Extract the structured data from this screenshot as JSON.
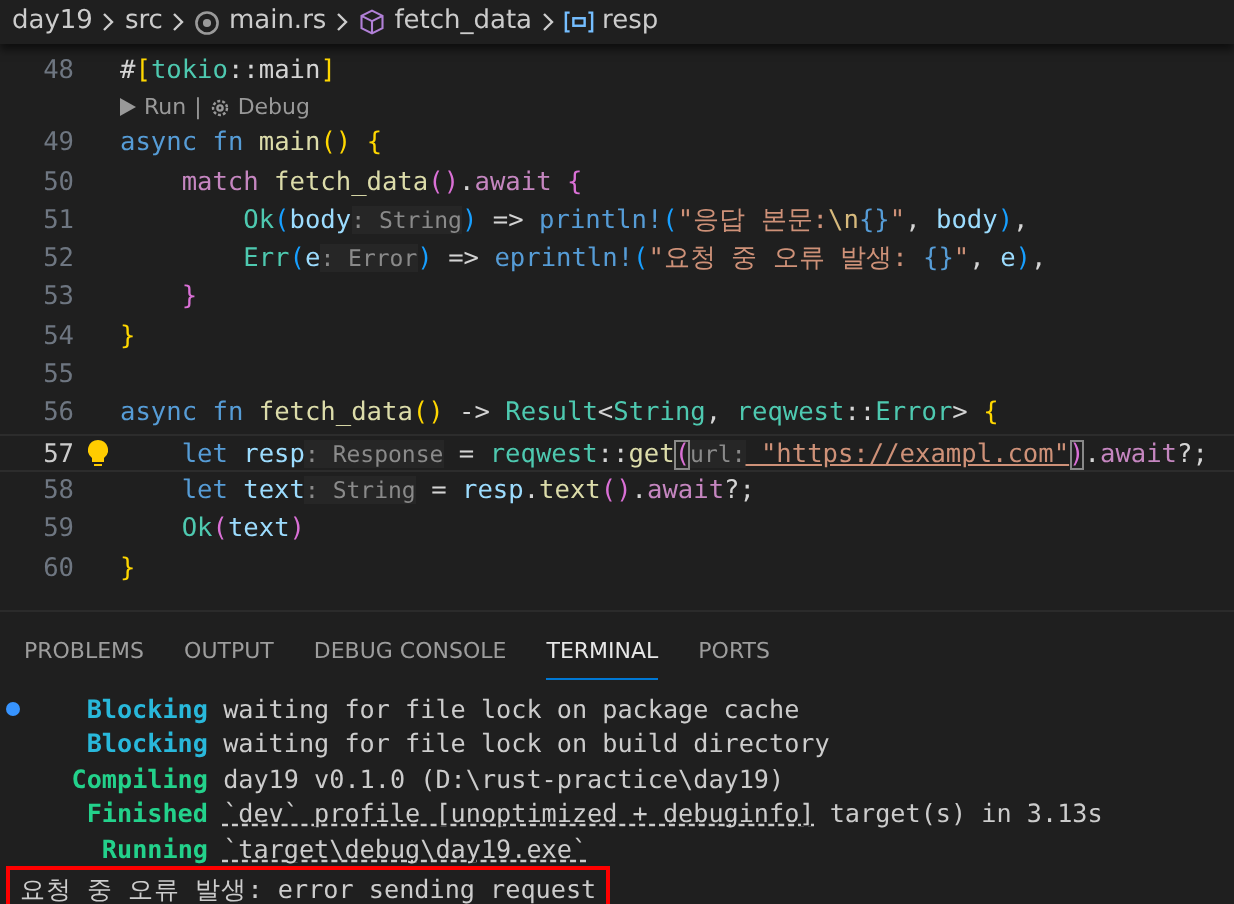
{
  "breadcrumb": [
    {
      "label": "day19",
      "kind": "folder"
    },
    {
      "label": "src",
      "kind": "folder"
    },
    {
      "label": "main.rs",
      "kind": "file"
    },
    {
      "label": "fetch_data",
      "kind": "function"
    },
    {
      "label": "resp",
      "kind": "variable"
    }
  ],
  "editor": {
    "lines": [
      {
        "number": "48",
        "current": false,
        "lightbulb": false,
        "tokens": [
          {
            "text": "#",
            "kind": "plain"
          },
          {
            "text": "[",
            "kind": "b1"
          },
          {
            "text": "tokio",
            "kind": "type"
          },
          {
            "text": "::",
            "kind": "plain"
          },
          {
            "text": "main",
            "kind": "plain"
          },
          {
            "text": "]",
            "kind": "b1"
          }
        ]
      },
      {
        "number": "49",
        "current": false,
        "lightbulb": false,
        "codelens": {
          "separator": "|",
          "items": [
            {
              "label": "Run",
              "kind": "run"
            },
            {
              "label": "Debug",
              "kind": "debug"
            }
          ]
        },
        "tokens": [
          {
            "text": "async ",
            "kind": "keyword"
          },
          {
            "text": "fn ",
            "kind": "keyword"
          },
          {
            "text": "main",
            "kind": "func"
          },
          {
            "text": "(",
            "kind": "b1"
          },
          {
            "text": ") ",
            "kind": "b1"
          },
          {
            "text": "{",
            "kind": "b1"
          }
        ]
      },
      {
        "number": "50",
        "current": false,
        "lightbulb": false,
        "tokens": [
          {
            "text": "    match ",
            "kind": "control"
          },
          {
            "text": "fetch_data",
            "kind": "func"
          },
          {
            "text": "(",
            "kind": "b2"
          },
          {
            "text": ")",
            "kind": "b2"
          },
          {
            "text": ".",
            "kind": "plain"
          },
          {
            "text": "await ",
            "kind": "control"
          },
          {
            "text": "{",
            "kind": "b2"
          }
        ]
      },
      {
        "number": "51",
        "current": false,
        "lightbulb": false,
        "tokens": [
          {
            "text": "        Ok",
            "kind": "type"
          },
          {
            "text": "(",
            "kind": "b3"
          },
          {
            "text": "body",
            "kind": "var"
          },
          {
            "text": ": String",
            "kind": "hint"
          },
          {
            "text": ")",
            "kind": "b3"
          },
          {
            "text": " => ",
            "kind": "plain"
          },
          {
            "text": "println!",
            "kind": "macro"
          },
          {
            "text": "(",
            "kind": "b3"
          },
          {
            "text": "\"응답 본문:",
            "kind": "string"
          },
          {
            "text": "\\n",
            "kind": "escape"
          },
          {
            "text": "{}",
            "kind": "format"
          },
          {
            "text": "\"",
            "kind": "string"
          },
          {
            "text": ", ",
            "kind": "plain"
          },
          {
            "text": "body",
            "kind": "var"
          },
          {
            "text": ")",
            "kind": "b3"
          },
          {
            "text": ",",
            "kind": "plain"
          }
        ]
      },
      {
        "number": "52",
        "current": false,
        "lightbulb": false,
        "tokens": [
          {
            "text": "        Err",
            "kind": "type"
          },
          {
            "text": "(",
            "kind": "b3"
          },
          {
            "text": "e",
            "kind": "var"
          },
          {
            "text": ": Error",
            "kind": "hint"
          },
          {
            "text": ")",
            "kind": "b3"
          },
          {
            "text": " => ",
            "kind": "plain"
          },
          {
            "text": "eprintln!",
            "kind": "macro"
          },
          {
            "text": "(",
            "kind": "b3"
          },
          {
            "text": "\"요청 중 오류 발생: ",
            "kind": "string"
          },
          {
            "text": "{}",
            "kind": "format"
          },
          {
            "text": "\"",
            "kind": "string"
          },
          {
            "text": ", ",
            "kind": "plain"
          },
          {
            "text": "e",
            "kind": "var"
          },
          {
            "text": ")",
            "kind": "b3"
          },
          {
            "text": ",",
            "kind": "plain"
          }
        ]
      },
      {
        "number": "53",
        "current": false,
        "lightbulb": false,
        "tokens": [
          {
            "text": "    }",
            "kind": "b2"
          }
        ]
      },
      {
        "number": "54",
        "current": false,
        "lightbulb": false,
        "tokens": [
          {
            "text": "}",
            "kind": "b1"
          }
        ]
      },
      {
        "number": "55",
        "current": false,
        "lightbulb": false
      },
      {
        "number": "56",
        "current": false,
        "lightbulb": false,
        "tokens": [
          {
            "text": "async ",
            "kind": "keyword"
          },
          {
            "text": "fn ",
            "kind": "keyword"
          },
          {
            "text": "fetch_data",
            "kind": "func"
          },
          {
            "text": "(",
            "kind": "b1"
          },
          {
            "text": ")",
            "kind": "b1"
          },
          {
            "text": " -> ",
            "kind": "plain"
          },
          {
            "text": "Result",
            "kind": "type"
          },
          {
            "text": "<",
            "kind": "plain"
          },
          {
            "text": "String",
            "kind": "type"
          },
          {
            "text": ", ",
            "kind": "plain"
          },
          {
            "text": "reqwest",
            "kind": "type"
          },
          {
            "text": "::",
            "kind": "plain"
          },
          {
            "text": "Error",
            "kind": "type"
          },
          {
            "text": "> ",
            "kind": "plain"
          },
          {
            "text": "{",
            "kind": "b1"
          }
        ]
      },
      {
        "number": "57",
        "current": true,
        "lightbulb": true,
        "tokens": [
          {
            "text": "    let ",
            "kind": "keyword"
          },
          {
            "text": "resp",
            "kind": "var"
          },
          {
            "text": ": Response",
            "kind": "hint"
          },
          {
            "text": " = ",
            "kind": "plain"
          },
          {
            "text": "reqwest",
            "kind": "type"
          },
          {
            "text": "::",
            "kind": "plain"
          },
          {
            "text": "get",
            "kind": "func"
          },
          {
            "text": "(",
            "kind": "bmatch"
          },
          {
            "text": "url:",
            "kind": "hint"
          },
          {
            "text": " \"https://exampl.com\"",
            "kind": "link"
          },
          {
            "text": ")",
            "kind": "bmatch"
          },
          {
            "text": ".",
            "kind": "plain"
          },
          {
            "text": "await",
            "kind": "control"
          },
          {
            "text": "?;",
            "kind": "plain"
          }
        ]
      },
      {
        "number": "58",
        "current": false,
        "lightbulb": false,
        "tokens": [
          {
            "text": "    let ",
            "kind": "keyword"
          },
          {
            "text": "text",
            "kind": "var"
          },
          {
            "text": ": String",
            "kind": "hint"
          },
          {
            "text": " = ",
            "kind": "plain"
          },
          {
            "text": "resp",
            "kind": "var"
          },
          {
            "text": ".",
            "kind": "plain"
          },
          {
            "text": "text",
            "kind": "func"
          },
          {
            "text": "(",
            "kind": "b2"
          },
          {
            "text": ")",
            "kind": "b2"
          },
          {
            "text": ".",
            "kind": "plain"
          },
          {
            "text": "await",
            "kind": "control"
          },
          {
            "text": "?;",
            "kind": "plain"
          }
        ]
      },
      {
        "number": "59",
        "current": false,
        "lightbulb": false,
        "tokens": [
          {
            "text": "    Ok",
            "kind": "type"
          },
          {
            "text": "(",
            "kind": "b2"
          },
          {
            "text": "text",
            "kind": "var"
          },
          {
            "text": ")",
            "kind": "b2"
          }
        ]
      },
      {
        "number": "60",
        "current": false,
        "lightbulb": false,
        "tokens": [
          {
            "text": "}",
            "kind": "b1"
          }
        ]
      }
    ]
  },
  "panel": {
    "tabs": [
      {
        "label": "PROBLEMS",
        "selected": false
      },
      {
        "label": "OUTPUT",
        "selected": false
      },
      {
        "label": "DEBUG CONSOLE",
        "selected": false
      },
      {
        "label": "TERMINAL",
        "selected": true
      },
      {
        "label": "PORTS",
        "selected": false
      }
    ],
    "terminal": [
      {
        "kind": "info",
        "status": "Blocking",
        "marker": true,
        "segments": [
          {
            "text": "waiting for file lock on package cache",
            "link": false
          }
        ]
      },
      {
        "kind": "info",
        "status": "Blocking",
        "marker": false,
        "segments": [
          {
            "text": "waiting for file lock on build directory",
            "link": false
          }
        ]
      },
      {
        "kind": "success",
        "status": "Compiling",
        "marker": false,
        "segments": [
          {
            "text": "day19 v0.1.0 (D:\\rust-practice\\day19)",
            "link": false
          }
        ]
      },
      {
        "kind": "success",
        "status": "Finished",
        "marker": false,
        "segments": [
          {
            "text": "`dev` profile [unoptimized + debuginfo]",
            "link": true
          },
          {
            "text": "target(s) in 3.13s",
            "link": false
          }
        ]
      },
      {
        "kind": "success",
        "status": "Running",
        "marker": false,
        "segments": [
          {
            "text": "`target\\debug\\day19.exe`",
            "link": true
          }
        ]
      },
      {
        "kind": "output",
        "highlighted": true,
        "text": "요청 중 오류 발생: error sending request"
      }
    ]
  }
}
